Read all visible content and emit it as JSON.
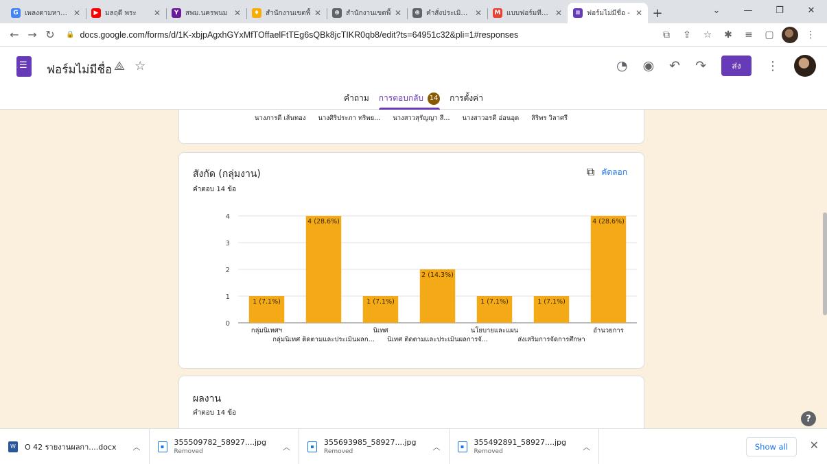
{
  "browser": {
    "tabs": [
      {
        "label": "เพลงตามหาสาม",
        "fav_color": "#4285f4",
        "fav": "G"
      },
      {
        "label": "มลฤดี พระ",
        "fav_color": "#ff0000",
        "fav": "▶"
      },
      {
        "label": "สพม.นครพนม",
        "fav_color": "#6a1b9a",
        "fav": "Y"
      },
      {
        "label": "สำนักงานเขตพื้",
        "fav_color": "#f9ab00",
        "fav": "♦"
      },
      {
        "label": "สำนักงานเขตพื้",
        "fav_color": "#5f6368",
        "fav": "⊕"
      },
      {
        "label": "คำสั่งประเมินITA",
        "fav_color": "#5f6368",
        "fav": "⊕"
      },
      {
        "label": "แบบฟอร์มทีแชร์",
        "fav_color": "#ea4335",
        "fav": "M"
      },
      {
        "label": "ฟอร์มไม่มีชื่อ -",
        "fav_color": "#673ab7",
        "fav": "≡"
      }
    ],
    "url": "docs.google.com/forms/d/1K-xbjpAgxhGYxMfTOffaelFtTEg6sQBk8jcTIKR0qb8/edit?ts=64951c32&pli=1#responses"
  },
  "header": {
    "form_title": "ฟอร์มไม่มีชื่อ",
    "send_label": "ส่ง",
    "tabs": {
      "questions": "คำถาม",
      "responses": "การตอบกลับ",
      "responses_count": "14",
      "settings": "การตั้งค่า"
    }
  },
  "card_top": {
    "names": [
      "นางภารดี เส้นทอง",
      "นางศิริประภา ทริพย...",
      "นางสาวสุรัญญา สี...",
      "นางสาวอรดี อ่อนอุด",
      "สิริพร วิลาศรี"
    ]
  },
  "card_chart": {
    "title": "สังกัด (กลุ่มงาน)",
    "subtitle": "คำตอบ 14 ข้อ",
    "copy_label": "คัดลอก"
  },
  "chart_data": {
    "type": "bar",
    "categories": [
      "กลุ่มนิเทศฯ",
      "กลุ่มนิเทศ ติดตามและประเมินผลก...",
      "นิเทศ",
      "นิเทศ ติดตามและประเมินผลการจั...",
      "นโยบายและแผน",
      "ส่งเสริมการจัดการศึกษา",
      "อำนวยการ"
    ],
    "values": [
      1,
      4,
      1,
      2,
      1,
      1,
      4
    ],
    "data_labels": [
      "1 (7.1%)",
      "4 (28.6%)",
      "1 (7.1%)",
      "2 (14.3%)",
      "1 (7.1%)",
      "1 (7.1%)",
      "4 (28.6%)"
    ],
    "y_ticks": [
      "0",
      "1",
      "2",
      "3",
      "4"
    ],
    "ylim": [
      0,
      4
    ],
    "bar_color": "#f4a917",
    "grid": true
  },
  "card_next": {
    "title": "ผลงาน",
    "subtitle": "คำตอบ 14 ข้อ"
  },
  "downloads": {
    "items": [
      {
        "name": "O 42 รายงานผลกา....docx",
        "status": ""
      },
      {
        "name": "355509782_58927....jpg",
        "status": "Removed"
      },
      {
        "name": "355693985_58927....jpg",
        "status": "Removed"
      },
      {
        "name": "355492891_58927....jpg",
        "status": "Removed"
      }
    ],
    "show_all": "Show all"
  }
}
